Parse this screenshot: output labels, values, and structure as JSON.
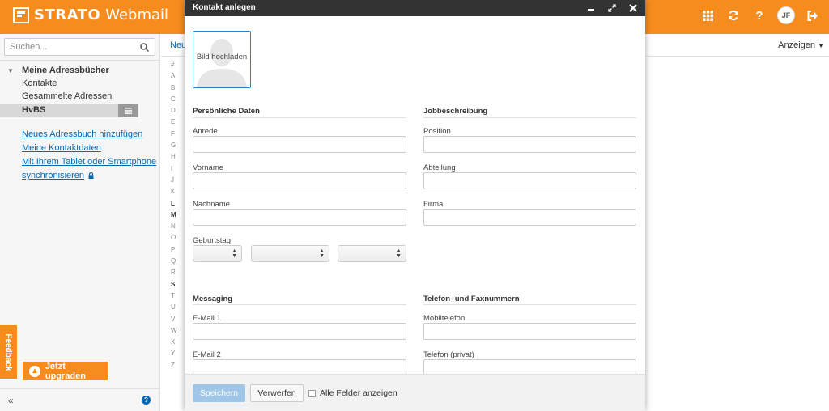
{
  "app": {
    "brand": "STRATO",
    "product": "Webmail",
    "avatar_initials": "JF",
    "colors": {
      "accent": "#f78c1e",
      "link": "#0068b4",
      "modal_header": "#333333"
    },
    "top_icons": [
      "apps-grid-icon",
      "refresh-icon",
      "help-icon",
      "avatar",
      "logout-icon"
    ]
  },
  "sidebar": {
    "search_placeholder": "Suchen...",
    "tree_title": "Meine Adressbücher",
    "items": [
      "Kontakte",
      "Gesammelte Adressen"
    ],
    "selected_item": "HvBS",
    "links": [
      "Neues Adressbuch hinzufügen",
      "Meine Kontaktdaten",
      "Mit Ihrem Tablet oder Smartphone",
      "synchronisieren"
    ],
    "feedback_label": "Feedback",
    "upgrade_label": "Jetzt upgraden",
    "collapse_symbol": "«"
  },
  "main": {
    "new_label": "Neu",
    "view_label": "Anzeigen",
    "alphabet": [
      "#",
      "A",
      "B",
      "C",
      "D",
      "E",
      "F",
      "G",
      "H",
      "I",
      "J",
      "K",
      "L",
      "M",
      "N",
      "O",
      "P",
      "Q",
      "R",
      "S",
      "T",
      "U",
      "V",
      "W",
      "X",
      "Y",
      "Z"
    ],
    "alphabet_bold": [
      "L",
      "M",
      "S"
    ]
  },
  "modal": {
    "title": "Kontakt anlegen",
    "photo_label": "Bild hochladen",
    "sections": {
      "personal": "Persönliche Daten",
      "job": "Jobbeschreibung",
      "messaging": "Messaging",
      "phone": "Telefon- und Faxnummern"
    },
    "fields": {
      "anrede": "Anrede",
      "vorname": "Vorname",
      "nachname": "Nachname",
      "geburtstag": "Geburtstag",
      "position": "Position",
      "abteilung": "Abteilung",
      "firma": "Firma",
      "email1": "E-Mail 1",
      "email2": "E-Mail 2",
      "mobil": "Mobiltelefon",
      "telefon_privat": "Telefon (privat)"
    },
    "footer": {
      "save": "Speichern",
      "discard": "Verwerfen",
      "show_all": "Alle Felder anzeigen"
    }
  }
}
